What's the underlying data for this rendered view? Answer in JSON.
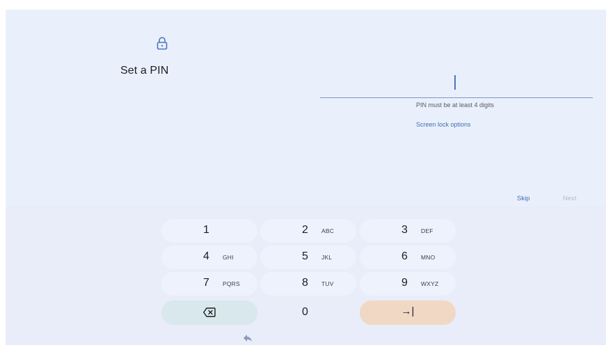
{
  "setup": {
    "title": "Set a PIN",
    "pin_value": "",
    "hint": "PIN must be at least 4 digits",
    "screen_lock_options": "Screen lock options",
    "skip": "Skip",
    "next": "Next"
  },
  "keypad": {
    "keys": [
      {
        "digit": "1",
        "letters": ""
      },
      {
        "digit": "2",
        "letters": "ABC"
      },
      {
        "digit": "3",
        "letters": "DEF"
      },
      {
        "digit": "4",
        "letters": "GHI"
      },
      {
        "digit": "5",
        "letters": "JKL"
      },
      {
        "digit": "6",
        "letters": "MNO"
      },
      {
        "digit": "7",
        "letters": "PQRS"
      },
      {
        "digit": "8",
        "letters": "TUV"
      },
      {
        "digit": "9",
        "letters": "WXYZ"
      },
      {
        "digit": "0",
        "letters": ""
      }
    ],
    "delete_icon": "backspace-icon",
    "enter_glyph": "→|",
    "enter_icon": "enter-icon"
  },
  "nav": {
    "back_icon": "back-icon"
  },
  "colors": {
    "background": "#eaf0fb",
    "accent": "#3f6db8",
    "delete_key": "#d8e8ec",
    "enter_key": "#f1d8c4",
    "disabled_text": "#b4bccd"
  }
}
